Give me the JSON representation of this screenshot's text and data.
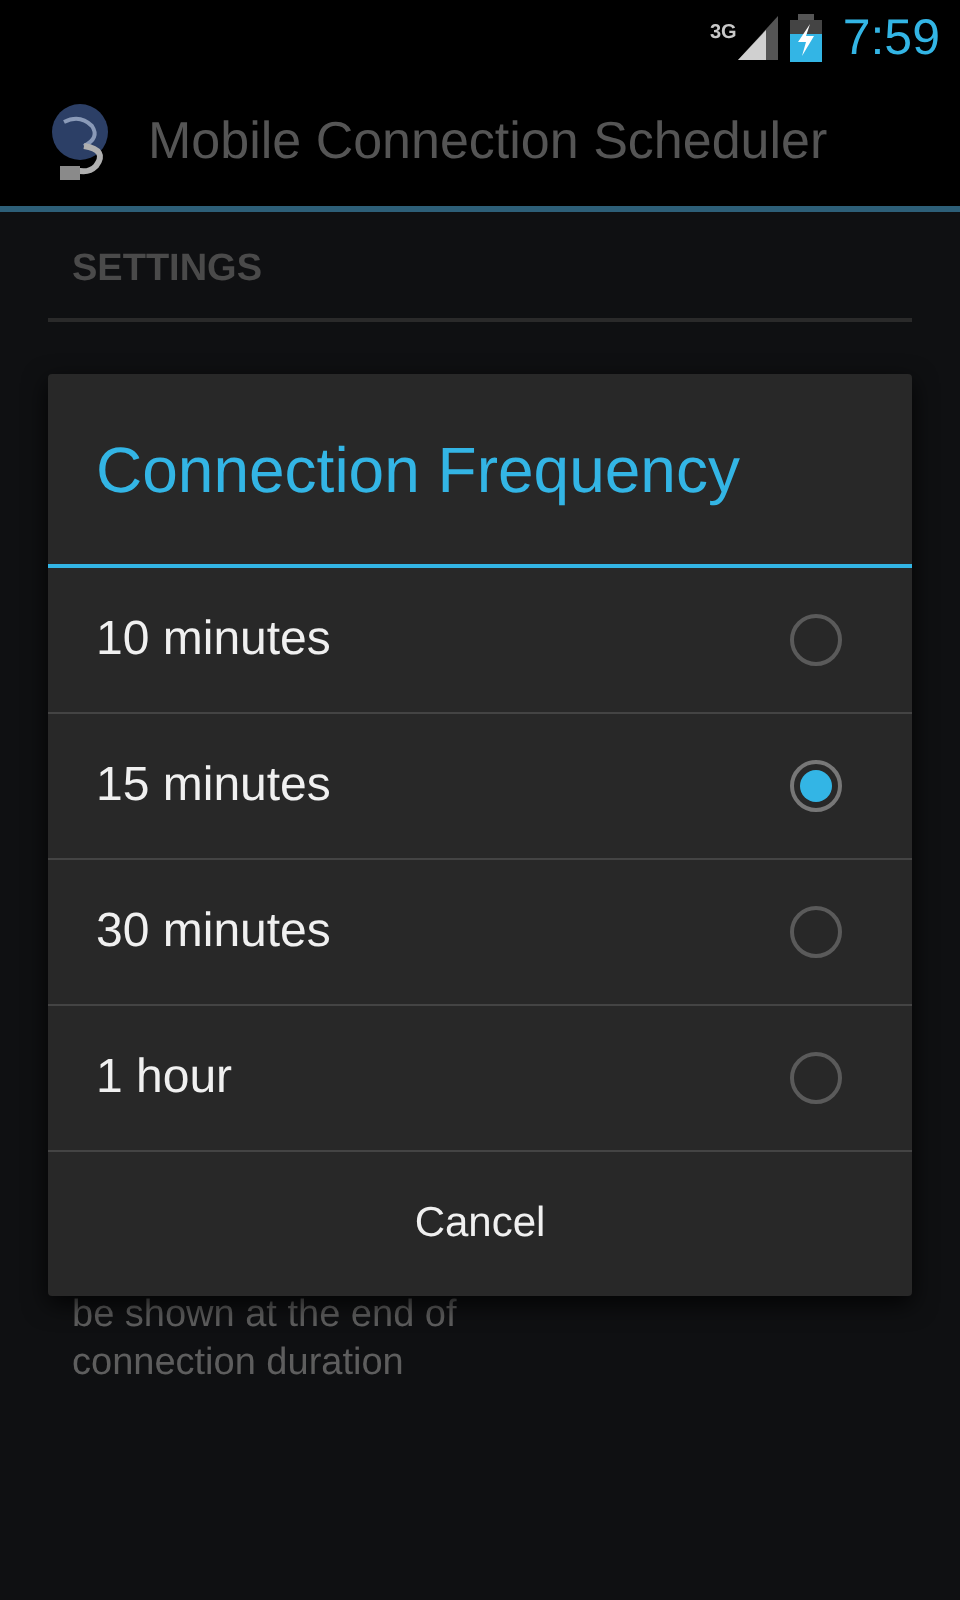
{
  "status_bar": {
    "network": "3G",
    "time": "7:59"
  },
  "action_bar": {
    "title": "Mobile Connection Scheduler"
  },
  "settings": {
    "header": "SETTINGS",
    "partial_summary": [
      "be shown at the end of",
      "connection duration"
    ]
  },
  "dialog": {
    "title": "Connection Frequency",
    "options": [
      {
        "label": "10 minutes",
        "selected": false
      },
      {
        "label": "15 minutes",
        "selected": true
      },
      {
        "label": "30 minutes",
        "selected": false
      },
      {
        "label": "1 hour",
        "selected": false
      }
    ],
    "cancel": "Cancel"
  }
}
